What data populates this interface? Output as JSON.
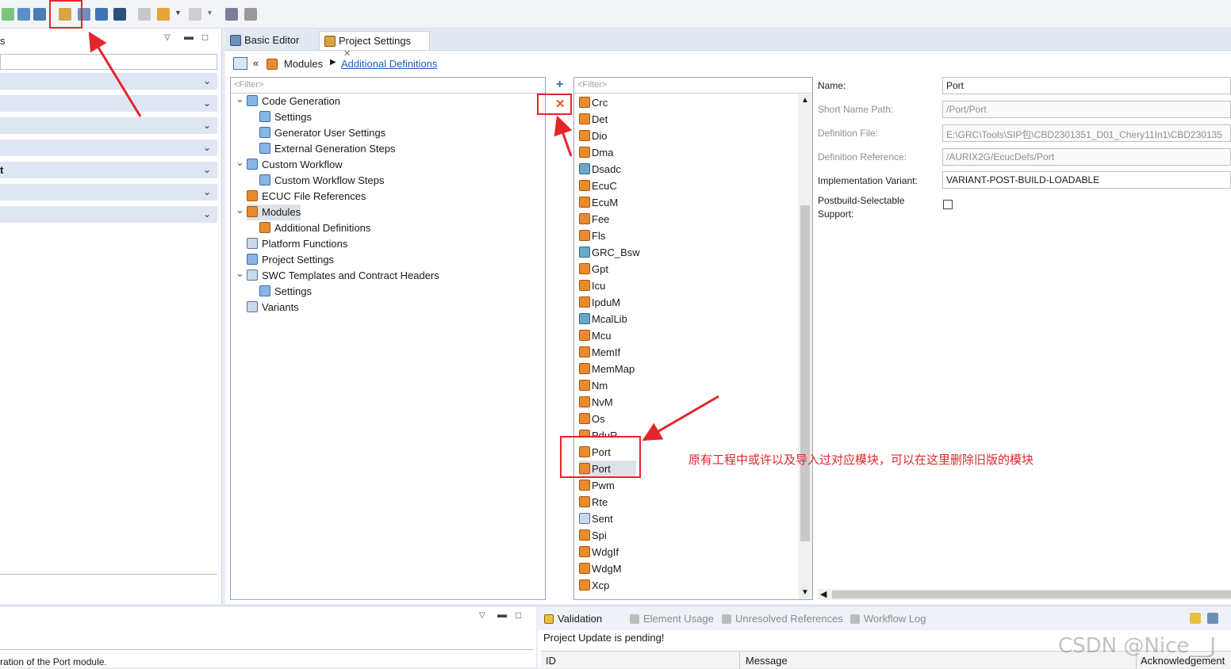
{
  "toolbar": {
    "icons": [
      "validate-icon",
      "settings-icon",
      "save-icon",
      "project-settings-icon",
      "edit-icon",
      "import-icon",
      "search-icon",
      "back-icon",
      "forward-icon",
      "hex-icon",
      "format-icon"
    ]
  },
  "left_panel": {
    "title_fragment": "s",
    "row_fragment": "t",
    "rows": 7,
    "status_text": "ration of the Port module."
  },
  "editor": {
    "tabs": [
      {
        "label": "Basic Editor",
        "active": false
      },
      {
        "label": "Project Settings",
        "active": true
      }
    ],
    "breadcrumb": {
      "root": "Modules",
      "current": "Additional Definitions"
    }
  },
  "settings_tree": {
    "filter_placeholder": "<Filter>",
    "items": [
      {
        "label": "Code Generation",
        "level": 0,
        "expanded": true
      },
      {
        "label": "Settings",
        "level": 1
      },
      {
        "label": "Generator User Settings",
        "level": 1
      },
      {
        "label": "External Generation Steps",
        "level": 1
      },
      {
        "label": "Custom Workflow",
        "level": 0,
        "expanded": true
      },
      {
        "label": "Custom Workflow Steps",
        "level": 1
      },
      {
        "label": "ECUC File References",
        "level": 0
      },
      {
        "label": "Modules",
        "level": 0,
        "expanded": true,
        "selected": true
      },
      {
        "label": "Additional Definitions",
        "level": 1
      },
      {
        "label": "Platform Functions",
        "level": 0
      },
      {
        "label": "Project Settings",
        "level": 0
      },
      {
        "label": "SWC Templates and Contract Headers",
        "level": 0,
        "expanded": true
      },
      {
        "label": "Settings",
        "level": 1
      },
      {
        "label": "Variants",
        "level": 0
      }
    ]
  },
  "module_list": {
    "filter_placeholder": "<Filter>",
    "items": [
      "Crc",
      "Det",
      "Dio",
      "Dma",
      "Dsadc",
      "EcuC",
      "EcuM",
      "Fee",
      "Fls",
      "GRC_Bsw",
      "Gpt",
      "Icu",
      "IpduM",
      "McalLib",
      "Mcu",
      "MemIf",
      "MemMap",
      "Nm",
      "NvM",
      "Os",
      "PduR",
      "Port",
      "Port",
      "Pwm",
      "Rte",
      "Sent",
      "Spi",
      "WdgIf",
      "WdgM",
      "Xcp"
    ],
    "blue_items": [
      "Dsadc",
      "GRC_Bsw",
      "McalLib"
    ],
    "selected_index": 22
  },
  "properties": {
    "name_label": "Name:",
    "name_value": "Port",
    "short_name_label": "Short Name Path:",
    "short_name_value": "/Port/Port",
    "def_file_label": "Definition File:",
    "def_file_value": "E:\\GRC\\Tools\\SIP包\\CBD2301351_D01_Chery11In1\\CBD230135",
    "def_ref_label": "Definition Reference:",
    "def_ref_value": "/AURIX2G/EcucDefs/Port",
    "impl_label": "Implementation Variant:",
    "impl_value": "VARIANT-POST-BUILD-LOADABLE",
    "postbuild_label_1": "Postbuild-Selectable",
    "postbuild_label_2": "Support:"
  },
  "bottom": {
    "tabs": [
      "Validation",
      "Element Usage",
      "Unresolved References",
      "Workflow Log"
    ],
    "status": "Project Update is pending!",
    "columns": [
      "ID",
      "Message",
      "Acknowledgement"
    ]
  },
  "annotation": {
    "text": "原有工程中或许以及导入过对应模块，可以在这里删除旧版的模块",
    "color": "#e3262b"
  },
  "watermark": "CSDN @Nice__J"
}
